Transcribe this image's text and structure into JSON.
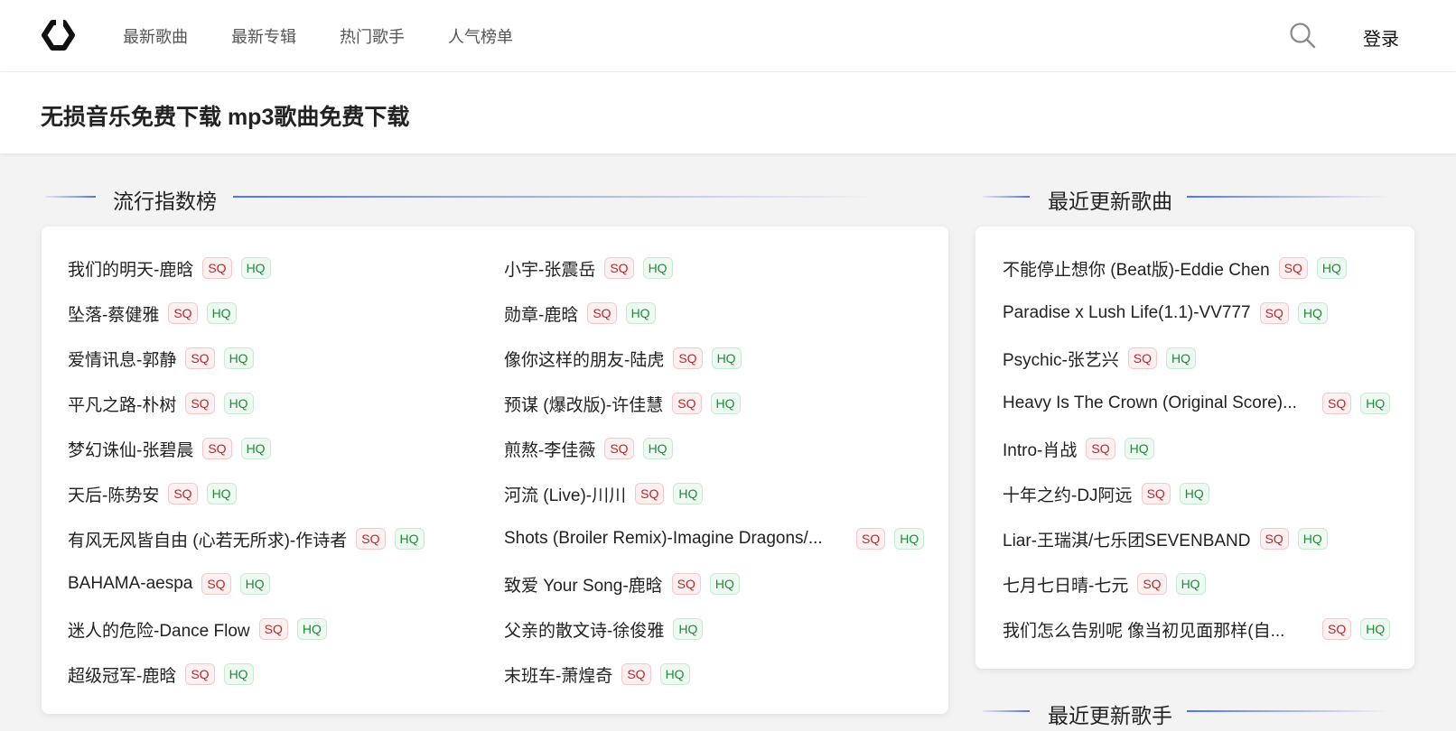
{
  "nav": {
    "items": [
      "最新歌曲",
      "最新专辑",
      "热门歌手",
      "人气榜单"
    ],
    "login": "登录"
  },
  "hero": {
    "title": "无损音乐免费下载 mp3歌曲免费下载"
  },
  "sections": {
    "chart_title": "流行指数榜",
    "recent_songs_title": "最近更新歌曲",
    "recent_artists_title": "最近更新歌手"
  },
  "chart_left": [
    {
      "name": "我们的明天-鹿晗",
      "sq": "SQ",
      "hq": "HQ"
    },
    {
      "name": "坠落-蔡健雅",
      "sq": "SQ",
      "hq": "HQ"
    },
    {
      "name": "爱情讯息-郭静",
      "sq": "SQ",
      "hq": "HQ"
    },
    {
      "name": "平凡之路-朴树",
      "sq": "SQ",
      "hq": "HQ"
    },
    {
      "name": "梦幻诛仙-张碧晨",
      "sq": "SQ",
      "hq": "HQ"
    },
    {
      "name": "天后-陈势安",
      "sq": "SQ",
      "hq": "HQ"
    },
    {
      "name": "有风无风皆自由 (心若无所求)-作诗者",
      "sq": "SQ",
      "hq": "HQ"
    },
    {
      "name": "BAHAMA-aespa",
      "sq": "SQ",
      "hq": "HQ"
    },
    {
      "name": "迷人的危险-Dance Flow",
      "sq": "SQ",
      "hq": "HQ"
    },
    {
      "name": "超级冠军-鹿晗",
      "sq": "SQ",
      "hq": "HQ"
    }
  ],
  "chart_right": [
    {
      "name": "小宇-张震岳",
      "sq": "SQ",
      "hq": "HQ"
    },
    {
      "name": "勋章-鹿晗",
      "sq": "SQ",
      "hq": "HQ"
    },
    {
      "name": "像你这样的朋友-陆虎",
      "sq": "SQ",
      "hq": "HQ"
    },
    {
      "name": "预谋 (爆改版)-许佳慧",
      "sq": "SQ",
      "hq": "HQ"
    },
    {
      "name": "煎熬-李佳薇",
      "sq": "SQ",
      "hq": "HQ"
    },
    {
      "name": "河流 (Live)-川川",
      "sq": "SQ",
      "hq": "HQ"
    },
    {
      "name": "Shots (Broiler Remix)-Imagine Dragons/...",
      "sq": "SQ",
      "hq": "HQ"
    },
    {
      "name": "致爱 Your Song-鹿晗",
      "sq": "SQ",
      "hq": "HQ"
    },
    {
      "name": "父亲的散文诗-徐俊雅",
      "sq": "",
      "hq": "HQ"
    },
    {
      "name": "末班车-萧煌奇",
      "sq": "SQ",
      "hq": "HQ"
    }
  ],
  "recent_songs": [
    {
      "name": "不能停止想你 (Beat版)-Eddie Chen",
      "sq": "SQ",
      "hq": "HQ"
    },
    {
      "name": "Paradise x Lush Life(1.1)-VV777",
      "sq": "SQ",
      "hq": "HQ"
    },
    {
      "name": "Psychic-张艺兴",
      "sq": "SQ",
      "hq": "HQ"
    },
    {
      "name": "Heavy Is The Crown (Original Score)...",
      "sq": "SQ",
      "hq": "HQ"
    },
    {
      "name": "Intro-肖战",
      "sq": "SQ",
      "hq": "HQ"
    },
    {
      "name": "十年之约-DJ阿远",
      "sq": "SQ",
      "hq": "HQ"
    },
    {
      "name": "Liar-王瑞淇/七乐团SEVENBAND",
      "sq": "SQ",
      "hq": "HQ"
    },
    {
      "name": "七月七日晴-七元",
      "sq": "SQ",
      "hq": "HQ"
    },
    {
      "name": "我们怎么告别呢 像当初见面那样(自...",
      "sq": "SQ",
      "hq": "HQ"
    }
  ]
}
